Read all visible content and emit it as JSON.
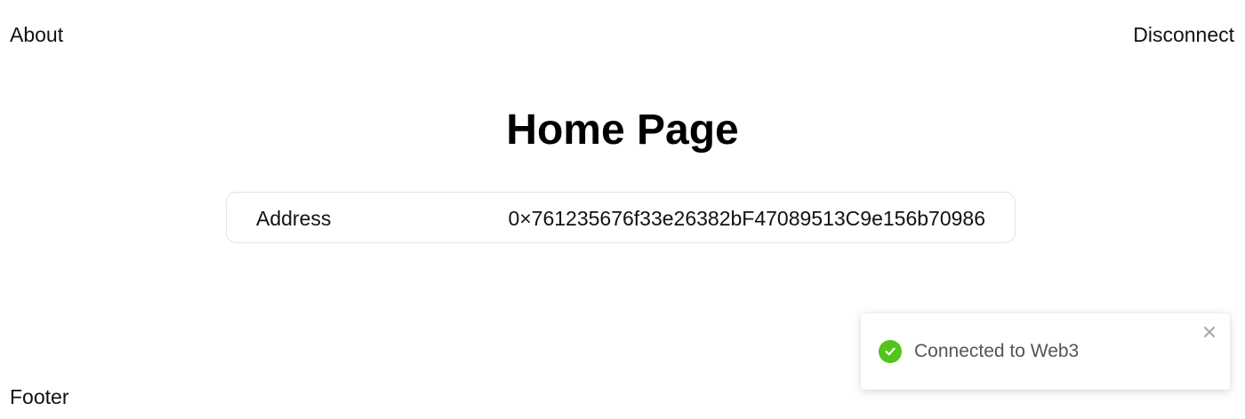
{
  "nav": {
    "about_label": "About",
    "disconnect_label": "Disconnect"
  },
  "main": {
    "title": "Home Page",
    "address_label": "Address",
    "address_value": "0×761235676f33e26382bF47089513C9e156b70986"
  },
  "footer": {
    "label": "Footer"
  },
  "toast": {
    "message": "Connected to Web3",
    "status_icon": "check-circle-icon",
    "close_icon": "close-icon",
    "success_color": "#52c41a"
  }
}
